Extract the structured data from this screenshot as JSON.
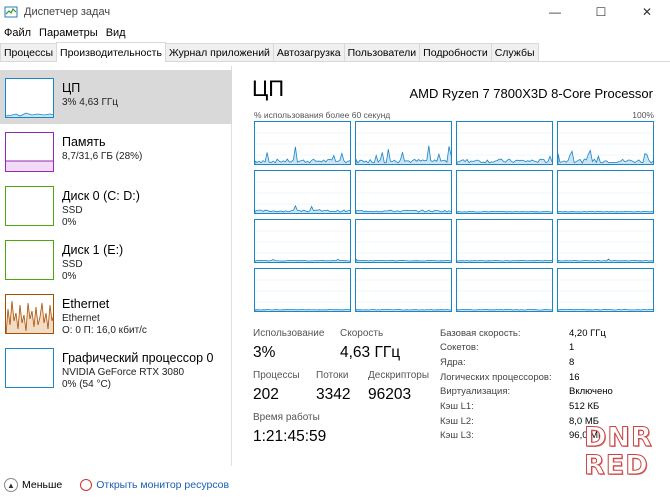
{
  "window": {
    "title": "Диспетчер задач"
  },
  "menu": [
    "Файл",
    "Параметры",
    "Вид"
  ],
  "tabs": [
    {
      "label": "Процессы",
      "active": false
    },
    {
      "label": "Производительность",
      "active": true
    },
    {
      "label": "Журнал приложений",
      "active": false
    },
    {
      "label": "Автозагрузка",
      "active": false
    },
    {
      "label": "Пользователи",
      "active": false
    },
    {
      "label": "Подробности",
      "active": false
    },
    {
      "label": "Службы",
      "active": false
    }
  ],
  "sidebar": {
    "items": [
      {
        "title": "ЦП",
        "line1": "3% 4,63 ГГц",
        "line2": "",
        "color": "#1a86c8",
        "selected": true
      },
      {
        "title": "Память",
        "line1": "8,7/31,6 ГБ (28%)",
        "line2": "",
        "color": "#9528b4",
        "selected": false
      },
      {
        "title": "Диск 0 (C: D:)",
        "line1": "SSD",
        "line2": "0%",
        "color": "#4da60c",
        "selected": false
      },
      {
        "title": "Диск 1 (E:)",
        "line1": "SSD",
        "line2": "0%",
        "color": "#4da60c",
        "selected": false
      },
      {
        "title": "Ethernet",
        "line1": "Ethernet",
        "line2": "О: 0 П: 16,0 кбит/с",
        "color": "#a74f01",
        "selected": false
      },
      {
        "title": "Графический процессор 0",
        "line1": "NVIDIA GeForce RTX 3080",
        "line2": "0% (54 °C)",
        "color": "#1a86c8",
        "selected": false
      }
    ]
  },
  "main": {
    "title": "ЦП",
    "cpu_name": "AMD Ryzen 7 7800X3D 8-Core Processor",
    "axis_left": "% использования более 60 секунд",
    "axis_right": "100%",
    "stats": {
      "usage_label": "Использование",
      "usage_value": "3%",
      "speed_label": "Скорость",
      "speed_value": "4,63 ГГц",
      "processes_label": "Процессы",
      "processes_value": "202",
      "threads_label": "Потоки",
      "threads_value": "3342",
      "handles_label": "Дескрипторы",
      "handles_value": "96203",
      "uptime_label": "Время работы",
      "uptime_value": "1:21:45:59"
    },
    "details": [
      {
        "label": "Базовая скорость:",
        "value": "4,20 ГГц"
      },
      {
        "label": "Сокетов:",
        "value": "1"
      },
      {
        "label": "Ядра:",
        "value": "8"
      },
      {
        "label": "Логических процессоров:",
        "value": "16"
      },
      {
        "label": "Виртуализация:",
        "value": "Включено"
      },
      {
        "label": "Кэш L1:",
        "value": "512 КБ"
      },
      {
        "label": "Кэш L2:",
        "value": "8,0 МБ"
      },
      {
        "label": "Кэш L3:",
        "value": "96,0 МБ"
      }
    ],
    "graph_color": "#1a86c8",
    "graph_fill": "#cde4f3"
  },
  "bottom": {
    "fewer_label": "Меньше",
    "monitor_link": "Открыть монитор ресурсов"
  },
  "watermark": {
    "line1": "DNR",
    "line2": "RED"
  }
}
